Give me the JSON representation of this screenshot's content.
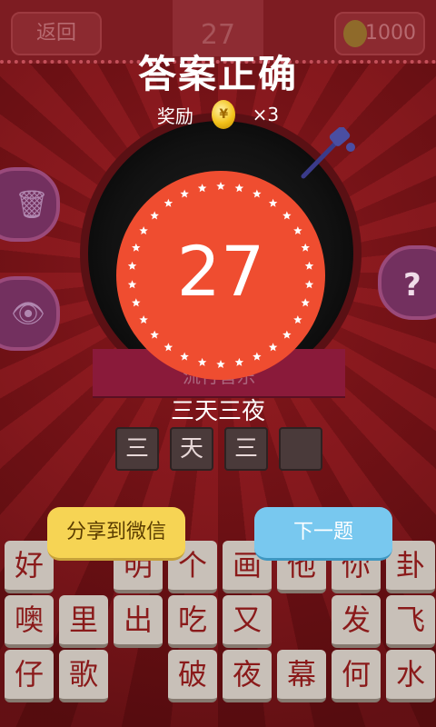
{
  "header": {
    "back_label": "返回",
    "level": "27",
    "coins": "1000",
    "coin_symbol": "¥"
  },
  "result": {
    "title": "答案正确",
    "reward_label": "奖励",
    "reward_multiplier": "×3",
    "level_number": "27"
  },
  "puzzle": {
    "category": "流行音乐",
    "answer": "三天三夜",
    "slots": [
      "三",
      "天",
      "三",
      ""
    ]
  },
  "actions": {
    "share_label": "分享到微信",
    "next_label": "下一题"
  },
  "keyboard": {
    "rows": [
      [
        "好",
        "",
        "明",
        "个",
        "画",
        "他",
        "你",
        "卦"
      ],
      [
        "噢",
        "里",
        "出",
        "吃",
        "又",
        "",
        "发",
        "飞"
      ],
      [
        "仔",
        "歌",
        "",
        "破",
        "夜",
        "幕",
        "何",
        "水"
      ]
    ]
  },
  "colors": {
    "badge": "#ef4d30",
    "share": "#f6d454",
    "next": "#78c8ef",
    "background": "#7a1418"
  }
}
